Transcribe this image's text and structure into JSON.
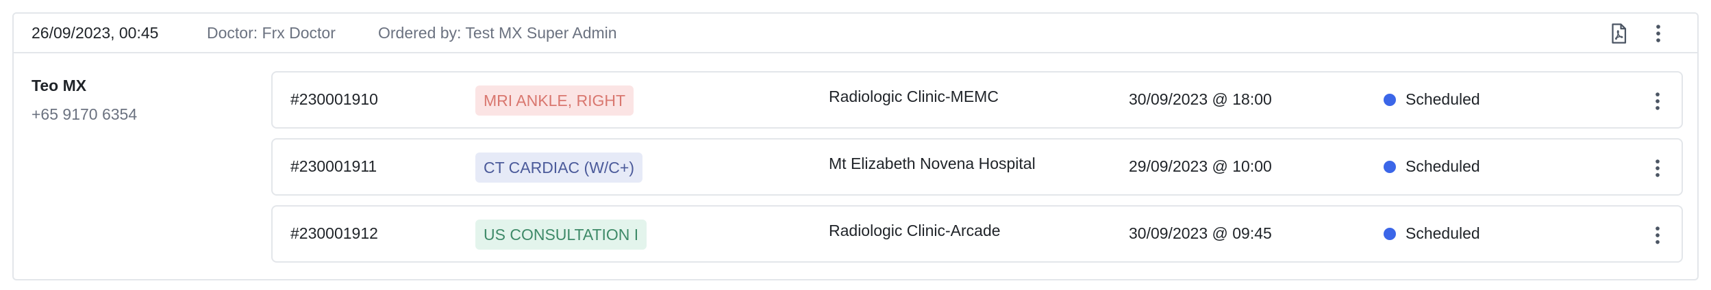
{
  "header": {
    "date": "26/09/2023, 00:45",
    "doctor": "Doctor: Frx Doctor",
    "ordered_by": "Ordered by: Test MX Super Admin",
    "pdf_icon": "pdf-file-icon",
    "more_icon": "more-vertical-icon"
  },
  "patient": {
    "name": "Teo MX",
    "phone": "+65 9170 6354"
  },
  "orders": [
    {
      "id": "#230001910",
      "exam": "MRI ANKLE, RIGHT",
      "exam_bg": "#fbe4e4",
      "exam_fg": "#d9776f",
      "location": "Radiologic Clinic-MEMC",
      "datetime": "30/09/2023 @ 18:00",
      "status": "Scheduled",
      "status_color": "#3b66e8"
    },
    {
      "id": "#230001911",
      "exam": "CT CARDIAC (W/C+)",
      "exam_bg": "#e6eaf7",
      "exam_fg": "#4b5a9a",
      "location": "Mt Elizabeth Novena Hospital",
      "datetime": "29/09/2023 @ 10:00",
      "status": "Scheduled",
      "status_color": "#3b66e8"
    },
    {
      "id": "#230001912",
      "exam": "US CONSULTATION I",
      "exam_bg": "#e3f4ec",
      "exam_fg": "#3e8a68",
      "location": "Radiologic Clinic-Arcade",
      "datetime": "30/09/2023 @ 09:45",
      "status": "Scheduled",
      "status_color": "#3b66e8"
    }
  ]
}
